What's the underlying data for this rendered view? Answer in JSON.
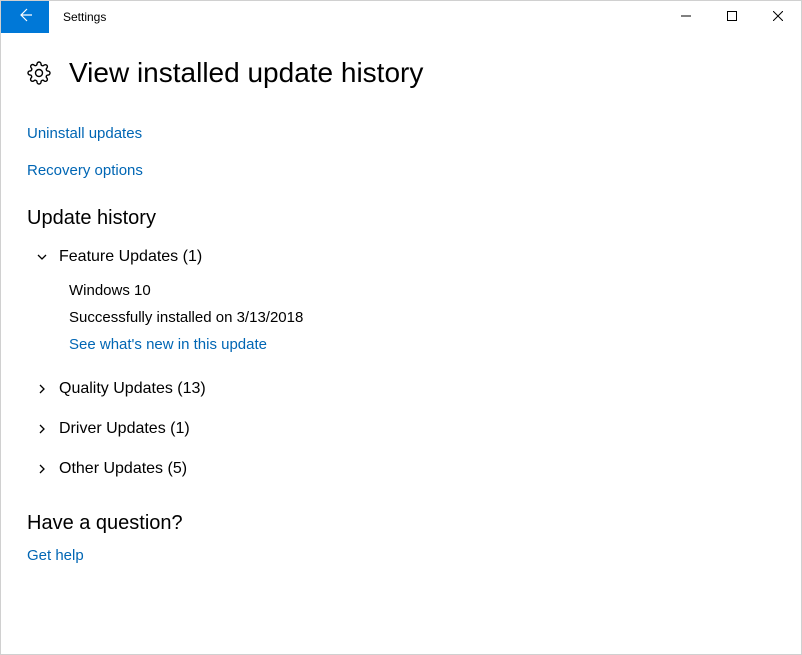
{
  "titlebar": {
    "title": "Settings"
  },
  "page": {
    "heading": "View installed update history"
  },
  "links": {
    "uninstall": "Uninstall updates",
    "recovery": "Recovery options"
  },
  "history": {
    "heading": "Update history",
    "groups": [
      {
        "label": "Feature Updates (1)",
        "expanded": true,
        "children": {
          "name": "Windows 10",
          "status": "Successfully installed on 3/13/2018",
          "whatsnew": "See what's new in this update"
        }
      },
      {
        "label": "Quality Updates (13)",
        "expanded": false
      },
      {
        "label": "Driver Updates (1)",
        "expanded": false
      },
      {
        "label": "Other Updates (5)",
        "expanded": false
      }
    ]
  },
  "question": {
    "heading": "Have a question?",
    "help": "Get help"
  }
}
